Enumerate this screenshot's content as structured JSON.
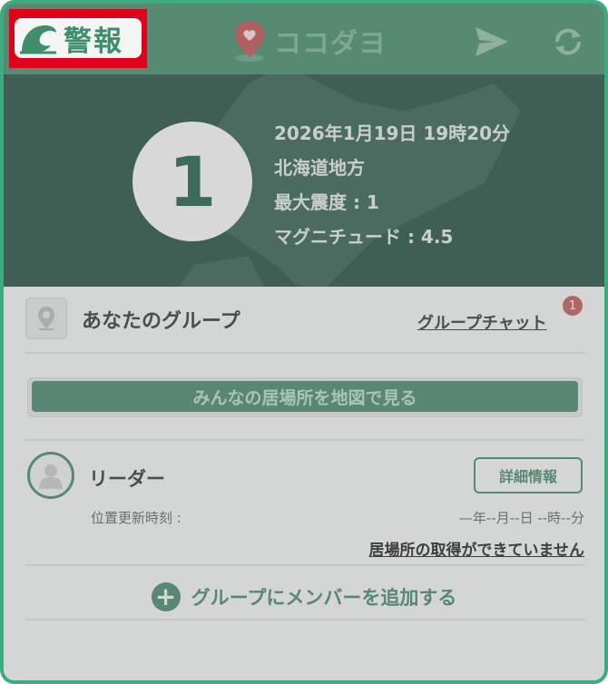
{
  "header": {
    "alert_label": "警報",
    "app_name": "ココダヨ",
    "icons": [
      "wave-icon",
      "location-pin-icon",
      "send-icon",
      "refresh-icon"
    ]
  },
  "quake": {
    "intensity": "1",
    "datetime": "2026年1月19日 19時20分",
    "region": "北海道地方",
    "max_intensity": "最大震度 : 1",
    "magnitude": "マグニチュード : 4.5"
  },
  "group": {
    "title": "あなたのグループ",
    "chat_link": "グループチャット",
    "chat_badge": "1",
    "map_button": "みんなの居場所を地図で見る"
  },
  "member": {
    "role": "リーダー",
    "detail_button": "詳細情報",
    "update_label": "位置更新時刻 :",
    "update_value": "—年--月--日 --時--分",
    "location_message": "居場所の取得ができていません"
  },
  "add_member": {
    "label": "グループにメンバーを追加する"
  },
  "colors": {
    "accent": "#3cab7f",
    "header": "#568a72",
    "alert_highlight": "#e0001b",
    "quake_panel": "#3f5f55"
  }
}
